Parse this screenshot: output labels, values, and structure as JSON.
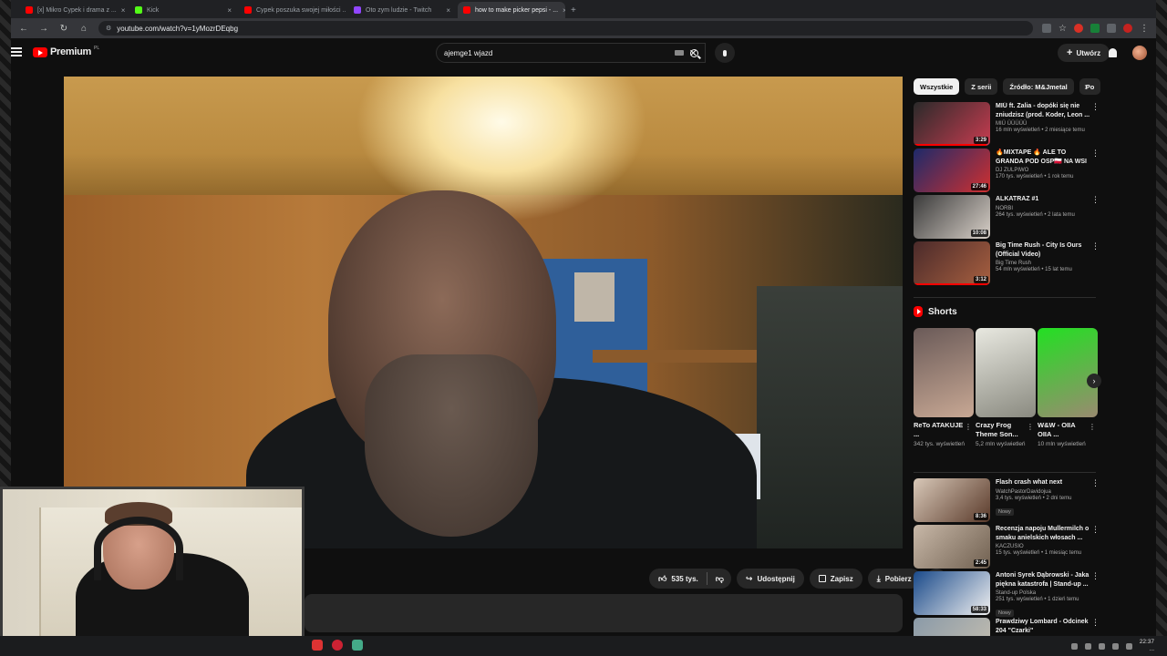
{
  "browser": {
    "tabs": [
      {
        "label": "[x] Mikro Cypek i drama z ...",
        "fav_color": "#ff0000",
        "active": false
      },
      {
        "label": "Kick",
        "fav_color": "#53fc18",
        "active": false
      },
      {
        "label": "Cypek poszuka swojej miłości ...",
        "fav_color": "#ff0000",
        "active": false
      },
      {
        "label": "Oto zym ludzie - Twitch",
        "fav_color": "#9146ff",
        "active": false
      },
      {
        "label": "how to make picker pepsi - ...",
        "fav_color": "#ff0000",
        "active": true
      }
    ],
    "url": "youtube.com/watch?v=1yMozrDEqbg"
  },
  "masthead": {
    "logo_text": "Premium",
    "logo_region": "PL",
    "search_value": "ajemge1 wjazd",
    "create_label": "Utwórz"
  },
  "actions": {
    "like_count": "535 tys.",
    "share_label": "Udostępnij",
    "save_label": "Zapisz",
    "download_label": "Pobierz"
  },
  "chips": [
    "Wszystkie",
    "Z serii",
    "Źródło: M&Jmetal",
    "Po"
  ],
  "recommendations_top": [
    {
      "title": "MIÜ ft. Zalia - dopóki się nie zniudzisz (prod. Koder, Leon ...",
      "channel": "MIÜ ÜÜÜÜÜ",
      "stats": "16 mln wyświetleń • 2 miesiące temu",
      "duration": "3:29",
      "thumb_colors": [
        "#2a2a2a",
        "#c83c50"
      ],
      "progress": 0.95
    },
    {
      "title": "🔥MIXTAPE 🔥 ALE TO GRANDA POD OSP🇵🇱 NA WSI",
      "channel": "DJ ZULPIWO",
      "stats": "170 tys. wyświetleń • 1 rok temu",
      "duration": "27:46",
      "thumb_colors": [
        "#1d2a6a",
        "#d03030"
      ],
      "progress": 0
    },
    {
      "title": "ALKATRAZ #1",
      "channel": "NORBI",
      "stats": "264 tys. wyświetleń • 2 lata temu",
      "duration": "10:08",
      "thumb_colors": [
        "#3a3a3a",
        "#d8d0c8"
      ],
      "progress": 0
    },
    {
      "title": "Big Time Rush - City Is Ours (Official Video)",
      "channel": "Big Time Rush",
      "stats": "54 mln wyświetleń • 15 lat temu",
      "duration": "3:12",
      "thumb_colors": [
        "#4a2a2a",
        "#a86040"
      ],
      "progress": 1.0
    }
  ],
  "shorts": {
    "heading": "Shorts",
    "items": [
      {
        "title": "ReTo ATAKUJE ...",
        "views": "342 tys. wyświetleń",
        "thumb_colors": [
          "#6a5a58",
          "#c8a894"
        ]
      },
      {
        "title": "Crazy Frog Theme Son...",
        "views": "5,2 mln wyświetleń",
        "thumb_colors": [
          "#e8e8e0",
          "#8a8a80"
        ]
      },
      {
        "title": "W&W - OIIA OIIA ...",
        "views": "10 mln wyświetleń",
        "thumb_colors": [
          "#22e022",
          "#9a8a70"
        ]
      }
    ]
  },
  "recommendations_bottom": [
    {
      "title": "Flash crash what next",
      "channel": "WatchPastorDavidojua",
      "stats": "3,4 tys. wyświetleń • 2 dni temu",
      "badge": "Nowy",
      "duration": "8:36",
      "thumb_colors": [
        "#d8c8b8",
        "#5a3a2a"
      ]
    },
    {
      "title": "Recenzja napoju Mullermilch o smaku anielskich włosach ...",
      "channel": "KACZUSIO",
      "stats": "15 tys. wyświetleń • 1 miesiąc temu",
      "badge": "",
      "duration": "2:45",
      "thumb_colors": [
        "#c8b8a8",
        "#706050"
      ]
    },
    {
      "title": "Antoni Syrek Dąbrowski - Jaka piękna katastrofa | Stand-up ...",
      "channel": "Stand-up Polska",
      "stats": "251 tys. wyświetleń • 1 dzień temu",
      "badge": "Nowy",
      "duration": "58:33",
      "thumb_colors": [
        "#1a4a8a",
        "#f0f0f0"
      ]
    },
    {
      "title": "Prawdziwy Lombard - Odcinek 204 \"Czarki\"",
      "channel": "",
      "stats": "",
      "badge": "",
      "duration": "",
      "thumb_colors": [
        "#8a9aa8",
        "#c8c0b0"
      ]
    }
  ],
  "taskbar": {
    "time": "22:37",
    "date": "..."
  }
}
